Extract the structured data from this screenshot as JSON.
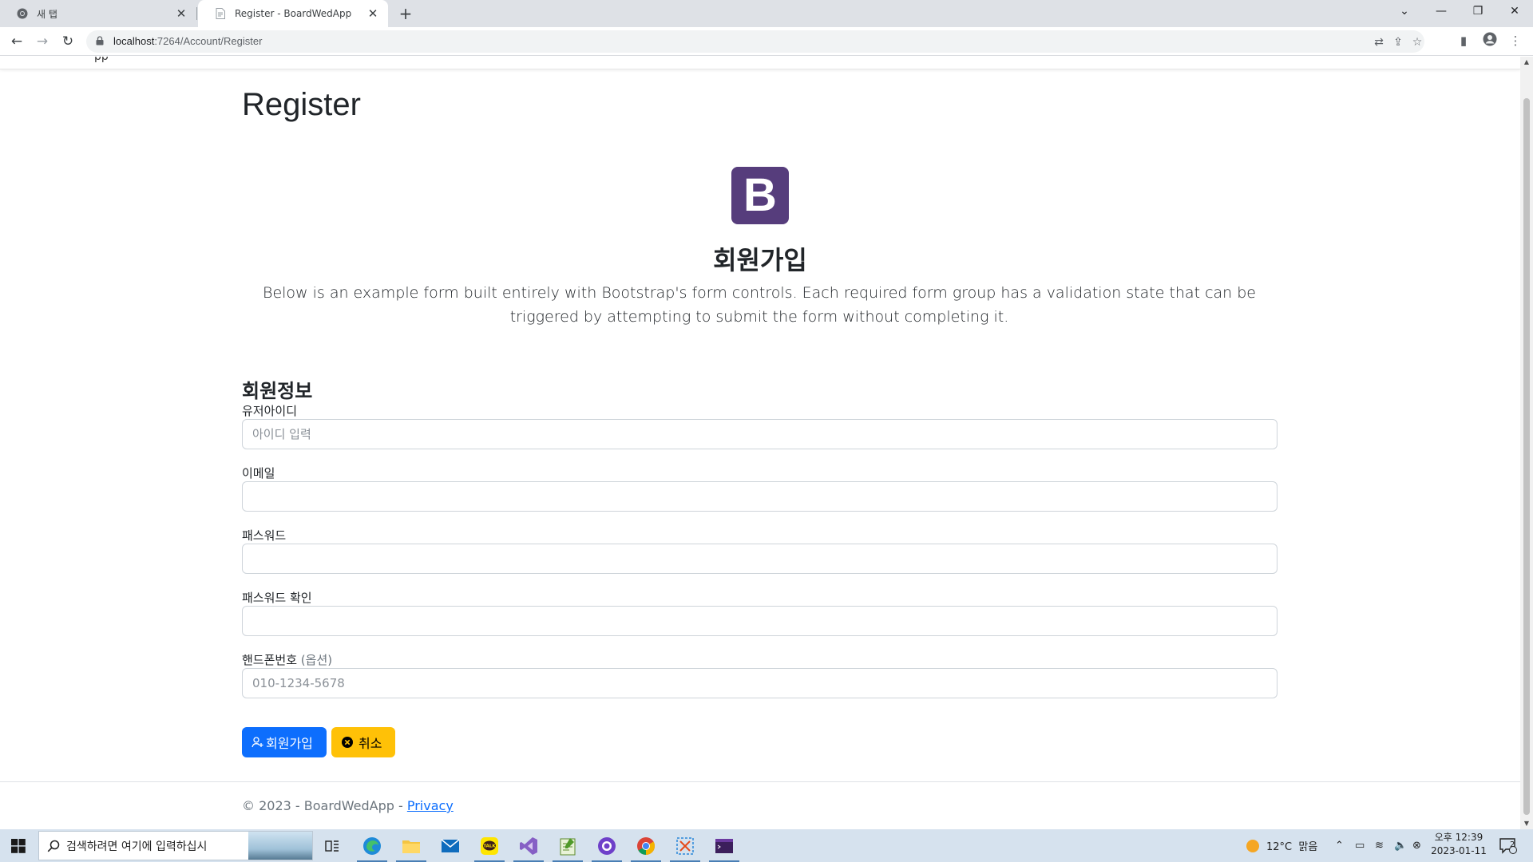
{
  "browser": {
    "tabs": [
      {
        "title": "새 탭"
      },
      {
        "title": "Register - BoardWedApp"
      }
    ],
    "url_host": "localhost",
    "url_rest": ":7264/Account/Register"
  },
  "page": {
    "nav_fragment": "pp",
    "heading": "Register",
    "logo_letter": "B",
    "signup_title": "회원가입",
    "lead": "Below is an example form built entirely with Bootstrap's form controls. Each required form group has a validation state that can be triggered by attempting to submit the form without completing it.",
    "section_title": "회원정보",
    "fields": [
      {
        "label": "유저아이디",
        "placeholder": "아이디 입력",
        "value": ""
      },
      {
        "label": "이메일",
        "placeholder": "",
        "value": ""
      },
      {
        "label": "패스워드",
        "placeholder": "",
        "value": ""
      },
      {
        "label": "패스워드 확인",
        "placeholder": "",
        "value": ""
      },
      {
        "label": "핸드폰번호",
        "label_optional": "(옵션)",
        "placeholder": "010-1234-5678",
        "value": ""
      }
    ],
    "submit_label": "회원가입",
    "cancel_label": "취소",
    "footer_text": "© 2023 - BoardWedApp - ",
    "footer_link": "Privacy"
  },
  "taskbar": {
    "search_placeholder": "검색하려면 여기에 입력하십시",
    "weather": "12°C  맑음",
    "time": "오후 12:39",
    "date": "2023-01-11",
    "notification_count": "2"
  },
  "colors": {
    "primary": "#0d6efd",
    "warning": "#ffc107",
    "bootstrap_purple": "#563d7c"
  }
}
